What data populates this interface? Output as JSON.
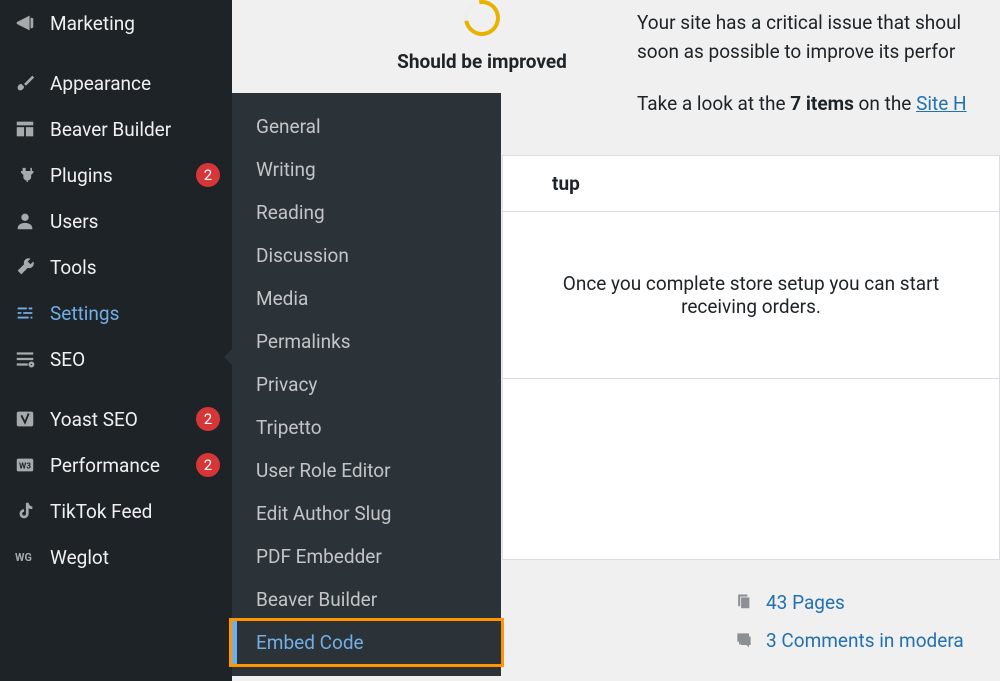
{
  "sidebar": {
    "items": [
      {
        "label": "Marketing"
      },
      {
        "label": "Appearance"
      },
      {
        "label": "Beaver Builder"
      },
      {
        "label": "Plugins",
        "badge": "2"
      },
      {
        "label": "Users"
      },
      {
        "label": "Tools"
      },
      {
        "label": "Settings"
      },
      {
        "label": "SEO"
      },
      {
        "label": "Yoast SEO",
        "badge": "2"
      },
      {
        "label": "Performance",
        "badge": "2"
      },
      {
        "label": "TikTok Feed"
      },
      {
        "label": "Weglot"
      }
    ]
  },
  "settings_submenu": [
    "General",
    "Writing",
    "Reading",
    "Discussion",
    "Media",
    "Permalinks",
    "Privacy",
    "Tripetto",
    "User Role Editor",
    "Edit Author Slug",
    "PDF Embedder",
    "Beaver Builder",
    "Embed Code"
  ],
  "health": {
    "status_label": "Should be improved",
    "line1": "Your site has a critical issue that shoul",
    "line2": "soon as possible to improve its perfor",
    "line3_pre": "Take a look at the ",
    "line3_bold": "7 items",
    "line3_mid": " on the ",
    "line3_link": "Site H"
  },
  "panel": {
    "header_suffix": "tup",
    "body_line1": "Once you complete store setup you can start",
    "body_line2": "receiving orders."
  },
  "stats": {
    "pages": "43 Pages",
    "comments": "3 Comments in modera"
  }
}
